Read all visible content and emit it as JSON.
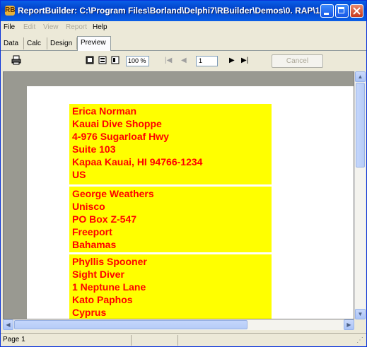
{
  "window": {
    "title": "ReportBuilder: C:\\Program Files\\Borland\\Delphi7\\RBuilder\\Demos\\0. RAP\\1. ...",
    "icon_glyph": "RB"
  },
  "menu": [
    {
      "label": "File",
      "enabled": true
    },
    {
      "label": "Edit",
      "enabled": false
    },
    {
      "label": "View",
      "enabled": false
    },
    {
      "label": "Report",
      "enabled": false
    },
    {
      "label": "Help",
      "enabled": true
    }
  ],
  "tabs": [
    "Data",
    "Calc",
    "Design",
    "Preview"
  ],
  "active_tab": "Preview",
  "toolbar": {
    "zoom_value": "100 %",
    "page_value": "1",
    "cancel_label": "Cancel"
  },
  "report": {
    "records": [
      {
        "lines": [
          "Erica Norman",
          "Kauai Dive Shoppe",
          "4-976 Sugarloaf Hwy",
          "Suite 103",
          "Kapaa Kauai, HI 94766-1234",
          "US"
        ]
      },
      {
        "lines": [
          "George Weathers",
          "Unisco",
          "PO Box Z-547",
          "Freeport",
          "Bahamas"
        ]
      },
      {
        "lines": [
          "Phyllis Spooner",
          "Sight Diver",
          "1 Neptune Lane",
          "Kato Paphos",
          "Cyprus"
        ]
      }
    ]
  },
  "status": {
    "page_text": "Page 1"
  },
  "colors": {
    "band": "#ffff00",
    "text": "#ff0000",
    "titlebar": "#0a5fe8"
  }
}
